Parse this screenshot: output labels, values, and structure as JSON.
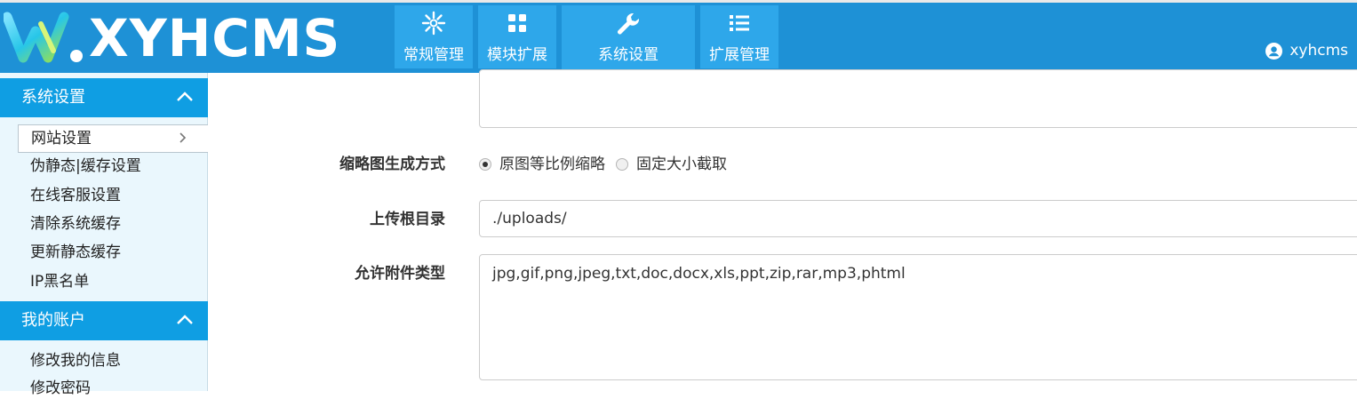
{
  "brand": {
    "logo_text": "XYHCMS"
  },
  "nav": {
    "tabs": [
      {
        "label": "常规管理",
        "icon": "settings-sun-icon"
      },
      {
        "label": "模块扩展",
        "icon": "grid-icon"
      },
      {
        "label": "系统设置",
        "icon": "wrench-icon",
        "active": true
      },
      {
        "label": "扩展管理",
        "icon": "list-icon"
      }
    ]
  },
  "user": {
    "name": "xyhcms",
    "icon": "user-circle-icon"
  },
  "sidebar": {
    "sections": [
      {
        "title": "系统设置",
        "items": [
          {
            "label": "网站设置",
            "active": true
          },
          {
            "label": "伪静态|缓存设置"
          },
          {
            "label": "在线客服设置"
          },
          {
            "label": "清除系统缓存"
          },
          {
            "label": "更新静态缓存"
          },
          {
            "label": "IP黑名单"
          }
        ]
      },
      {
        "title": "我的账户",
        "items": [
          {
            "label": "修改我的信息"
          },
          {
            "label": "修改密码"
          }
        ]
      }
    ]
  },
  "form": {
    "thumb": {
      "label": "缩略图生成方式",
      "options": [
        {
          "label": "原图等比例缩略",
          "checked": true
        },
        {
          "label": "固定大小截取",
          "checked": false
        }
      ]
    },
    "upload_dir": {
      "label": "上传根目录",
      "value": "./uploads/"
    },
    "allowed_types": {
      "label": "允许附件类型",
      "value": "jpg,gif,png,jpeg,txt,doc,docx,xls,ppt,zip,rar,mp3,phtml"
    }
  },
  "colors": {
    "header_bg": "#1e91d6",
    "tab_bg": "#2ea7ea",
    "sidebar_head_bg": "#0f9ee3",
    "sidebar_bg": "#eaf7fd"
  }
}
